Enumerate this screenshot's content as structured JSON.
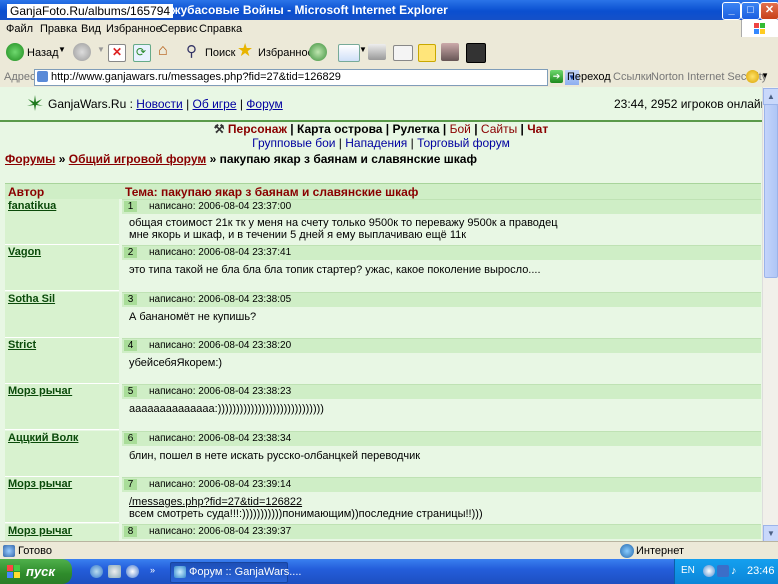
{
  "window": {
    "watermark": "GanjaFoto.Ru/albums/165794",
    "title": "жубасовые Войны - Microsoft Internet Explorer"
  },
  "menubar": [
    "Файл",
    "Правка",
    "Вид",
    "Избранное",
    "Сервис",
    "Справка"
  ],
  "toolbar": {
    "back_label": "Назад",
    "search_label": "Поиск",
    "favorites_label": "Избранное"
  },
  "address": {
    "label": "Адрес:",
    "url": "http://www.ganjawars.ru/messages.php?fid=27&tid=126829",
    "go_label": "Переход",
    "links_label": "Ссылки",
    "norton_label": "Norton Internet Security"
  },
  "site": {
    "name": "GanjaWars.Ru",
    "sep": ":",
    "nav": [
      "Новости",
      "Об игре",
      "Форум"
    ],
    "online": "23:44, 2952 игроков онлайн"
  },
  "menu1": [
    "Персонаж",
    "Карта острова",
    "Рулетка",
    "Бой",
    "Сайты",
    "Чат"
  ],
  "menu2": [
    "Групповые бои",
    "Нападения",
    "Торговый форум"
  ],
  "breadcrumb": {
    "forums": "Форумы",
    "general": "Общий игровой форум",
    "topic": "» пакупаю якар з баянам и славянские шкаф"
  },
  "table": {
    "author_header": "Автор",
    "topic_header": "Тема: пакупаю якар з баянам и славянские шкаф"
  },
  "posts": [
    {
      "num": "1",
      "author": "fanatikua",
      "written": "написано: 2006-08-04 23:37:00",
      "line1": "общая стоимост 21к тк у меня на счету только 9500к то переважу 9500к а праводец",
      "line2": "мне якорь и шкаф, и в течении 5 дней я ему выплачиваю ещё 11к"
    },
    {
      "num": "2",
      "author": "Vagon",
      "written": "написано: 2006-08-04 23:37:41",
      "line1": "это типа такой не бла бла бла топик стартер? ужас, какое поколение выросло....",
      "line2": ""
    },
    {
      "num": "3",
      "author": "Sotha Sil",
      "written": "написано: 2006-08-04 23:38:05",
      "line1": "А бананомёт не купишь?",
      "line2": ""
    },
    {
      "num": "4",
      "author": "Strict",
      "written": "написано: 2006-08-04 23:38:20",
      "line1": "убейсебяЯкорем:)",
      "line2": ""
    },
    {
      "num": "5",
      "author": "Морз рычаг",
      "written": "написано: 2006-08-04 23:38:23",
      "line1": "аааааааааааааа:)))))))))))))))))))))))))))))",
      "line2": ""
    },
    {
      "num": "6",
      "author": "Аццкий Волк",
      "written": "написано: 2006-08-04 23:38:34",
      "line1": "блин, пошел в нете искать русско-олбанцкей переводчик",
      "line2": ""
    },
    {
      "num": "7",
      "author": "Морз рычаг",
      "written": "написано: 2006-08-04 23:39:14",
      "line1": "/messages.php?fid=27&tid=126822",
      "line2": "всем смотреть суда!!!:)))))))))))понимающим))последние страницы!!)))"
    },
    {
      "num": "8",
      "author": "Морз рычаг",
      "written": "написано: 2006-08-04 23:39:37",
      "line1": "",
      "line2": ""
    }
  ],
  "statusbar": {
    "left": "Готово",
    "zone": "Интернет"
  },
  "taskbar": {
    "start": "пуск",
    "item": "Форум :: GanjaWars....",
    "lang": "EN",
    "clock": "23:46"
  }
}
